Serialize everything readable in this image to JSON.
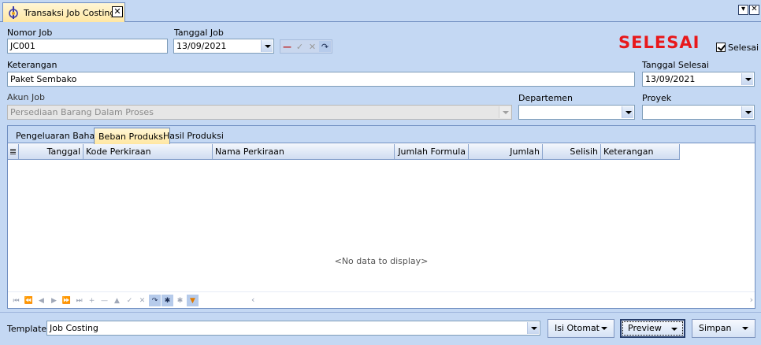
{
  "window": {
    "tab_title": "Transaksi Job Costing",
    "close_glyph": "✕",
    "pin_glyph": "▾",
    "win_close_glyph": "✕"
  },
  "form": {
    "nomor_job_label": "Nomor Job",
    "nomor_job_value": "JC001",
    "tanggal_job_label": "Tanggal Job",
    "tanggal_job_value": "13/09/2021",
    "status_text": "SELESAI",
    "selesai_checkbox_label": "Selesai",
    "selesai_checked": true,
    "keterangan_label": "Keterangan",
    "keterangan_value": "Paket Sembako",
    "tanggal_selesai_label": "Tanggal Selesai",
    "tanggal_selesai_value": "13/09/2021",
    "akun_job_label": "Akun Job",
    "akun_job_value": "Persediaan Barang Dalam Proses",
    "departemen_label": "Departemen",
    "departemen_value": "",
    "proyek_label": "Proyek",
    "proyek_value": ""
  },
  "mini_nav": [
    "—",
    "✓",
    "✕",
    "↷"
  ],
  "tabs": [
    {
      "label": "Pengeluaran Bahan",
      "active": false
    },
    {
      "label": "Beban Produksi",
      "active": true
    },
    {
      "label": "Hasil Produksi",
      "active": false
    }
  ],
  "grid": {
    "columns": [
      "Tanggal",
      "Kode Perkiraan",
      "Nama Perkiraan",
      "Jumlah Formula",
      "Jumlah",
      "Selisih",
      "Keterangan"
    ],
    "empty_text": "<No data to display>"
  },
  "navigator": [
    "⏮",
    "⏪",
    "◀",
    "▶",
    "⏩",
    "⏭",
    "+",
    "—",
    "▲",
    "✓",
    "✕",
    "↷",
    "✱",
    "✱",
    "▼"
  ],
  "bottom": {
    "template_label": "Template",
    "template_value": "Job Costing",
    "isi_otomat_label": "Isi Otomat",
    "preview_label": "Preview",
    "simpan_label": "Simpan"
  },
  "colors": {
    "status_red": "#e8181b",
    "frame_blue": "#c4d8f3",
    "active_tab": "#ffe7a2"
  }
}
